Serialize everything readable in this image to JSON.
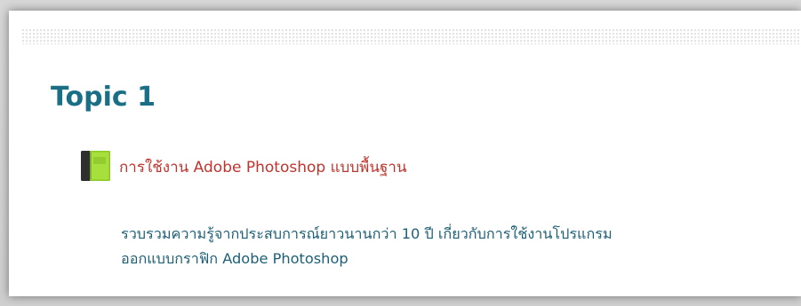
{
  "section": {
    "title": "Topic 1",
    "resource": {
      "icon": "book-icon",
      "label": "การใช้งาน Adobe Photoshop แบบพื้นฐาน"
    },
    "description": {
      "line1": "รวบรวมความรู้จากประสบการณ์ยาวนานกว่า 10 ปี เกี่ยวกับการใช้งานโปรแกรม",
      "line2": "ออกแบบกราฟิก Adobe Photoshop"
    }
  },
  "colors": {
    "title": "#1a6f86",
    "link": "#c0342e",
    "description": "#1d5f74",
    "book_green": "#8ac926",
    "book_dark": "#2f2f2f"
  }
}
